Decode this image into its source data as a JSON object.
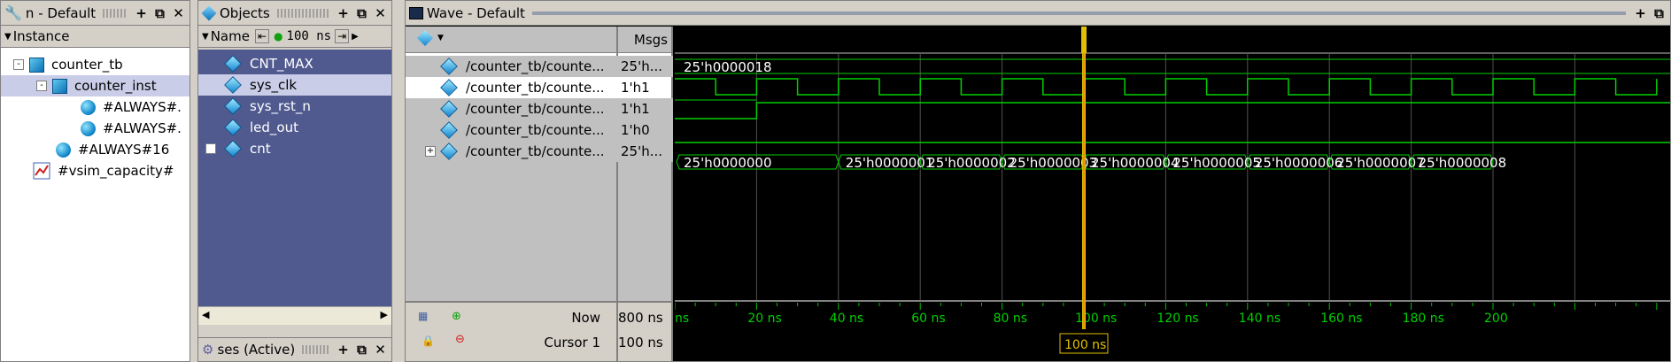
{
  "instance_pane": {
    "title": "n - Default",
    "header": "Instance",
    "items": [
      {
        "label": "counter_tb",
        "icon": "module-icon",
        "expander": "-"
      },
      {
        "label": "counter_inst",
        "icon": "module-icon",
        "expander": "-"
      },
      {
        "label": "#ALWAYS#.",
        "icon": "process-icon"
      },
      {
        "label": "#ALWAYS#.",
        "icon": "process-icon"
      },
      {
        "label": "#ALWAYS#16",
        "icon": "process-icon"
      },
      {
        "label": "#vsim_capacity#",
        "icon": "capacity-icon"
      }
    ]
  },
  "objects_pane": {
    "title": "Objects",
    "header": "Name",
    "time_field": "100 ns",
    "items": [
      {
        "label": "CNT_MAX"
      },
      {
        "label": "sys_clk"
      },
      {
        "label": "sys_rst_n"
      },
      {
        "label": "led_out"
      },
      {
        "label": "cnt",
        "expander": "+"
      }
    ],
    "bottom_title": "ses (Active)"
  },
  "wave_pane": {
    "title": "Wave - Default",
    "msgs_header": "Msgs",
    "signals": [
      {
        "name": "/counter_tb/counte...",
        "value": "25'h..."
      },
      {
        "name": "/counter_tb/counte...",
        "value": "1'h1"
      },
      {
        "name": "/counter_tb/counte...",
        "value": "1'h1"
      },
      {
        "name": "/counter_tb/counte...",
        "value": "1'h0"
      },
      {
        "name": "/counter_tb/counte...",
        "value": "25'h...",
        "expander": "+"
      }
    ],
    "now_label": "Now",
    "now_value": "800 ns",
    "cursor_label": "Cursor 1",
    "cursor_value": "100 ns",
    "cursor_tag": "100 ns",
    "const_value": "25'h0000018",
    "cnt_values": [
      "25'h0000000",
      "25'h0000001",
      "25'h0000002",
      "25'h0000003",
      "25'h0000004",
      "25'h0000005",
      "25'h0000006",
      "25'h0000007",
      "25'h0000008"
    ],
    "time_ticks": [
      "ns",
      "20 ns",
      "40 ns",
      "60 ns",
      "80 ns",
      "100 ns",
      "120 ns",
      "140 ns",
      "160 ns",
      "180 ns",
      "200"
    ],
    "colors": {
      "wave": "#00d000",
      "cursor": "#e0c000",
      "grid": "#505050",
      "selected_bg": "#c9cde8",
      "list_bg": "#505a8f"
    }
  }
}
